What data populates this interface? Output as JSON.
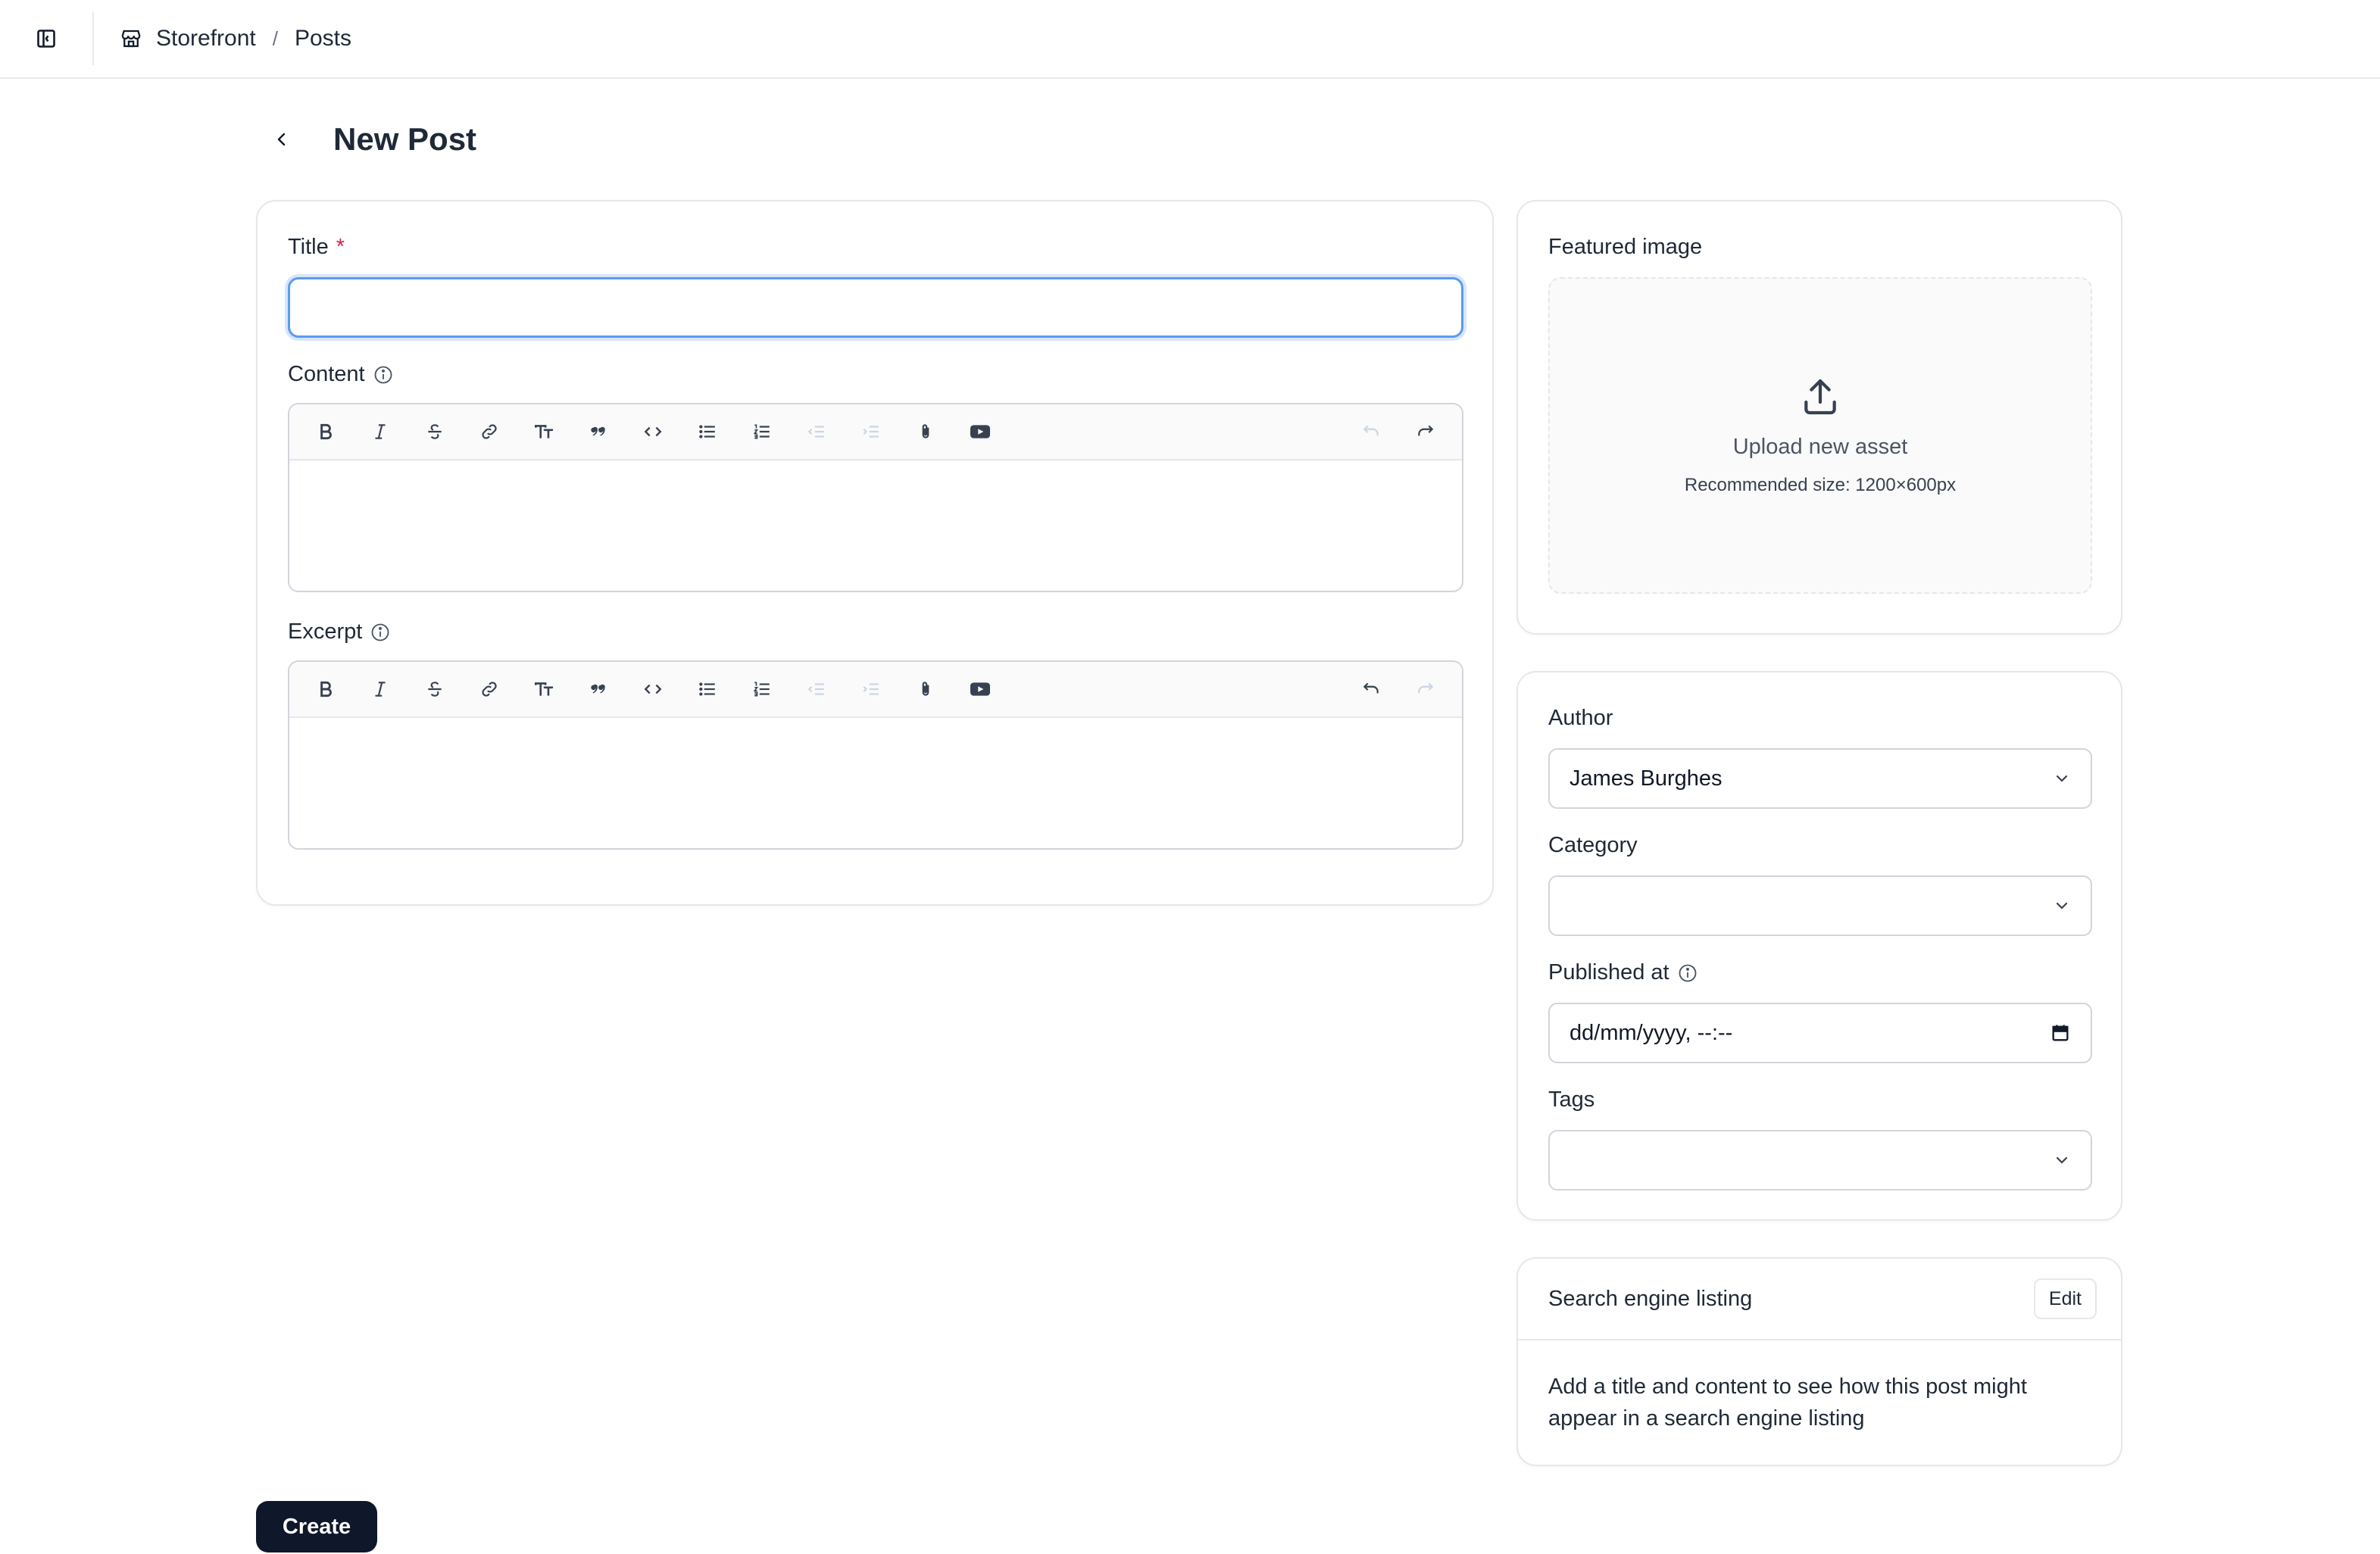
{
  "breadcrumb": {
    "store": "Storefront",
    "separator": "/",
    "section": "Posts"
  },
  "page": {
    "title": "New Post"
  },
  "form": {
    "title_label": "Title",
    "title_required_mark": "*",
    "title_value": "",
    "content_label": "Content",
    "excerpt_label": "Excerpt"
  },
  "featured_image": {
    "label": "Featured image",
    "upload_title": "Upload new asset",
    "upload_hint": "Recommended size: 1200×600px"
  },
  "meta": {
    "author_label": "Author",
    "author_value": "James Burghes",
    "category_label": "Category",
    "category_value": "",
    "published_label": "Published at",
    "published_value": "dd/mm/yyyy, --:--",
    "tags_label": "Tags",
    "tags_value": ""
  },
  "seo": {
    "title": "Search engine listing",
    "edit_label": "Edit",
    "body": "Add a title and content to see how this post might appear in a search engine listing"
  },
  "actions": {
    "create_label": "Create"
  },
  "icons": {
    "sidebar_toggle": "sidebar-toggle-icon",
    "store": "storefront-icon",
    "back": "chevron-left-icon",
    "upload": "upload-icon",
    "info": "info-icon",
    "chevron": "chevron-down-icon",
    "calendar": "calendar-icon"
  },
  "colors": {
    "primary_button": "#0f172a",
    "focus_ring": "#5b9bf0",
    "required": "#e11d48"
  }
}
